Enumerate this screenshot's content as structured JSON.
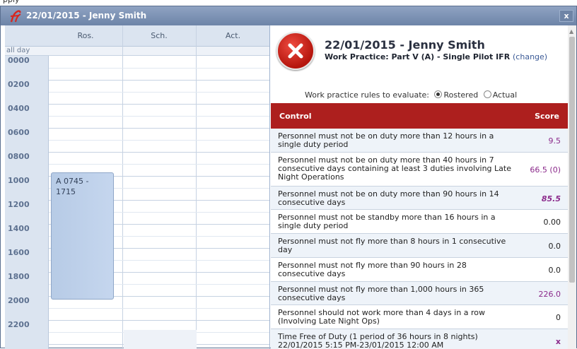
{
  "top_strip": {
    "text": "pply"
  },
  "window": {
    "title": "22/01/2015 - Jenny Smith",
    "close_label": "x"
  },
  "schedule": {
    "columns": [
      "Ros.",
      "Sch.",
      "Act."
    ],
    "all_day_label": "all day",
    "times": [
      "0000",
      "0200",
      "0400",
      "0600",
      "0800",
      "1000",
      "1200",
      "1400",
      "1600",
      "1800",
      "2000",
      "2200"
    ],
    "event": {
      "line1": "A 0745 -",
      "line2": "1715"
    }
  },
  "detail": {
    "title": "22/01/2015 - Jenny Smith",
    "subtitle": "Work Practice: Part V (A) - Single Pilot IFR",
    "change_link": "(change)",
    "rules_label": "Work practice rules to evaluate:",
    "rule_options": [
      "Rostered",
      "Actual"
    ],
    "selected_rule": "Rostered",
    "status": "fail",
    "columns": {
      "control": "Control",
      "score": "Score"
    },
    "colors": {
      "header": "#ad1f1e",
      "score_accent": "#8b2a8b",
      "status_icon": "#c8201a"
    },
    "rows": [
      {
        "text": "Personnel must not be on duty more than 12 hours in a single duty period",
        "score": "9.5"
      },
      {
        "text": "Personnel must not be on duty more than 40 hours in 7 consecutive days containing at least 3 duties involving Late Night Operations",
        "score": "66.5 (0)"
      },
      {
        "text": "Personnel must not be on duty more than 90 hours in 14 consecutive days",
        "score": "85.5"
      },
      {
        "text": "Personnel must not be standby more than 16 hours in a single duty period",
        "score": "0.00"
      },
      {
        "text": "Personnel must not fly more than 8 hours in 1 consecutive day",
        "score": "0.0"
      },
      {
        "text": "Personnel must not fly more than 90 hours in 28 consecutive days",
        "score": "0.0"
      },
      {
        "text": "Personnel must not fly more than 1,000 hours in 365 consecutive days",
        "score": "226.0"
      },
      {
        "text": "Personnel should not work more than 4 days in a row (Involving Late Night Ops)",
        "score": "0"
      },
      {
        "text": "Time Free of Duty (1 period of 36 hours in 8 nights) 22/01/2015 5:15 PM-23/01/2015 12:00 AM",
        "score": "x"
      }
    ]
  }
}
